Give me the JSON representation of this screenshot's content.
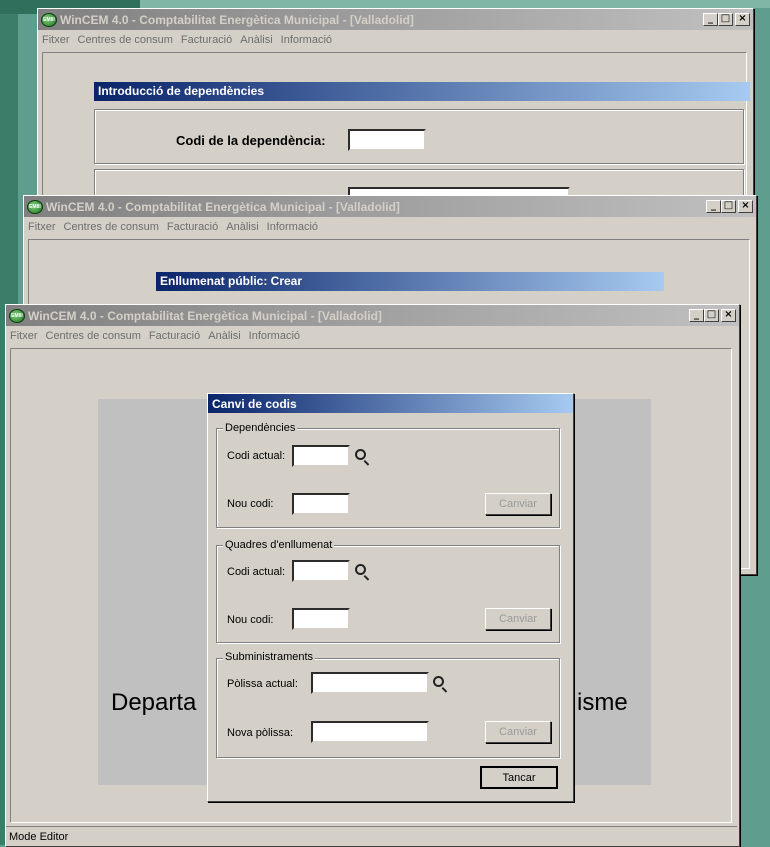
{
  "windows": {
    "back": {
      "title": "WinCEM 4.0 - Comptabilitat Energètica Municipal - [Valladolid]",
      "menu": [
        "Fitxer",
        "Centres de consum",
        "Facturació",
        "Anàlisi",
        "Informació"
      ],
      "form_title": "Introducció de dependències",
      "code_label": "Codi de la dependència:"
    },
    "middle": {
      "title": "WinCEM 4.0 - Comptabilitat Energètica Municipal - [Valladolid]",
      "menu": [
        "Fitxer",
        "Centres de consum",
        "Facturació",
        "Anàlisi",
        "Informació"
      ],
      "form_title": "Enllumenat públic: Crear"
    },
    "front": {
      "title": "WinCEM 4.0 - Comptabilitat Energètica Municipal - [Valladolid]",
      "menu": [
        "Fitxer",
        "Centres de consum",
        "Facturació",
        "Anàlisi",
        "Informació"
      ],
      "banner_left": "Departa",
      "banner_right": "isme",
      "status": "Mode Editor"
    }
  },
  "window_controls": {
    "minimize": "_",
    "maximize": "□",
    "close": "×"
  },
  "dialog": {
    "title": "Canvi de codis",
    "groups": [
      {
        "legend": "Dependències",
        "current_label": "Codi actual:",
        "new_label": "Nou codi:",
        "current_value": "",
        "new_value": "",
        "button": "Canviar"
      },
      {
        "legend": "Quadres d'enllumenat",
        "current_label": "Codi actual:",
        "new_label": "Nou codi:",
        "current_value": "",
        "new_value": "",
        "button": "Canviar"
      },
      {
        "legend": "Subministraments",
        "current_label": "Pòlissa actual:",
        "new_label": "Nova pòlissa:",
        "current_value": "",
        "new_value": "",
        "button": "Canviar"
      }
    ],
    "close_button": "Tancar"
  },
  "icons": {
    "app": "wincem-app-icon",
    "search": "magnifier-icon"
  }
}
